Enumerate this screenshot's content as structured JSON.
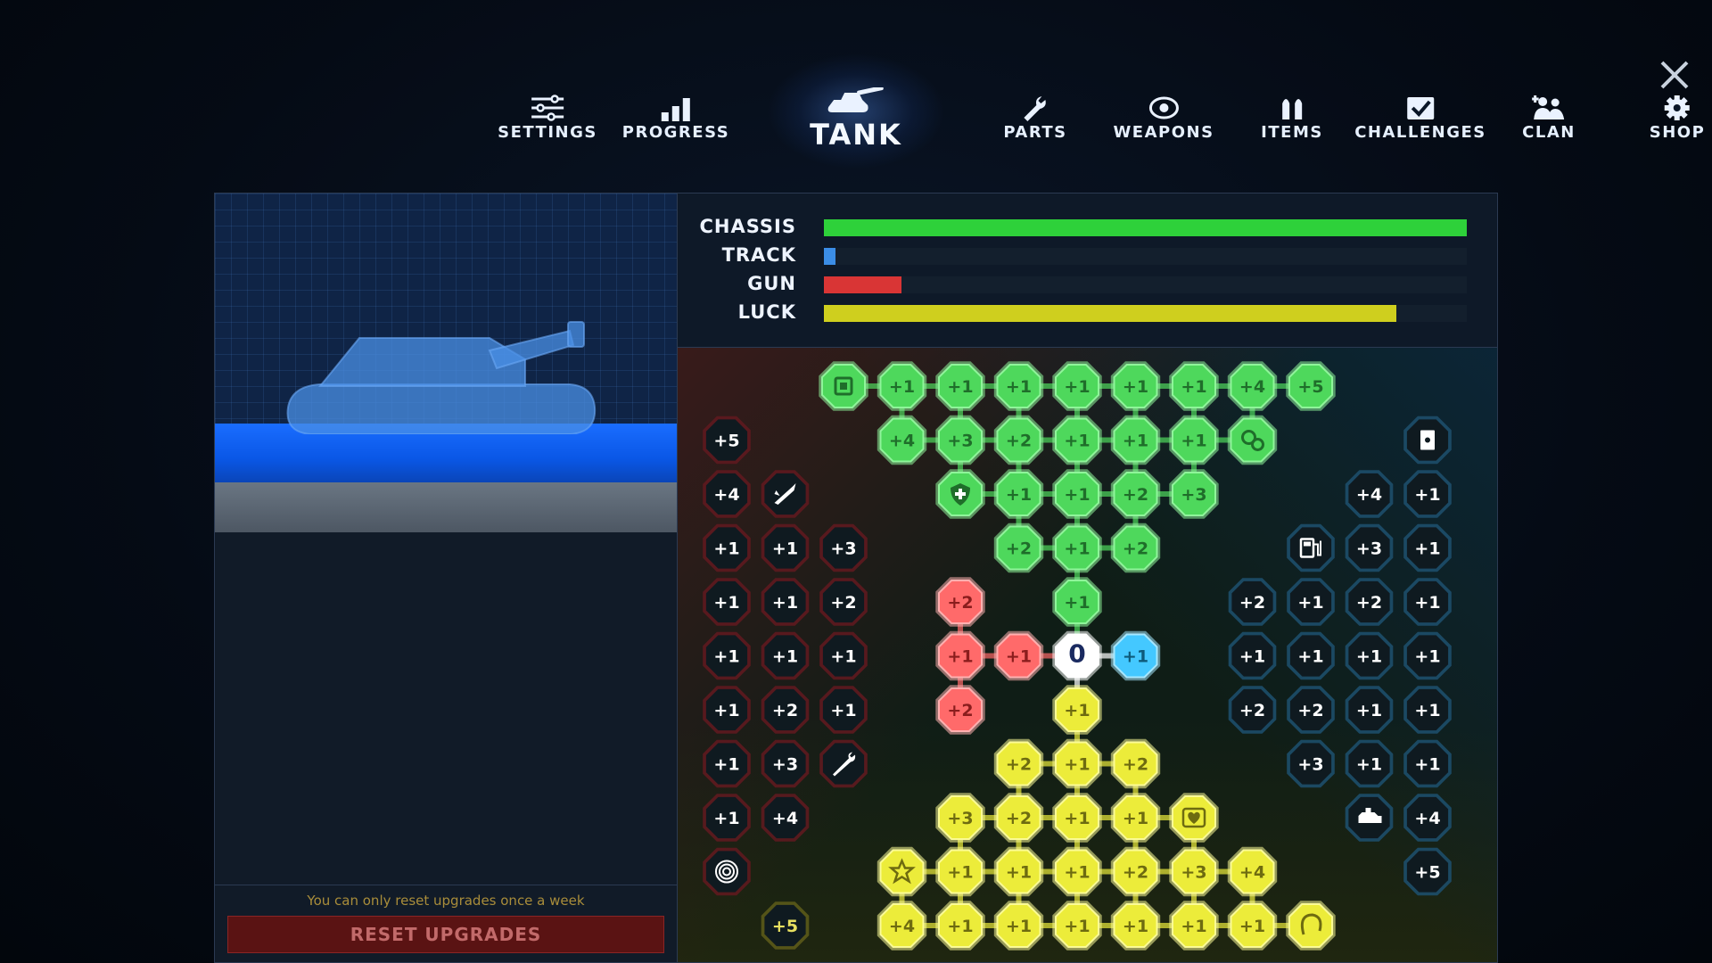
{
  "nav": {
    "items": [
      {
        "id": "settings",
        "label": "SETTINGS",
        "icon": "sliders-icon"
      },
      {
        "id": "progress",
        "label": "PROGRESS",
        "icon": "bar-chart-icon"
      },
      {
        "id": "tank",
        "label": "TANK",
        "icon": "tank-icon",
        "active": true
      },
      {
        "id": "parts",
        "label": "PARTS",
        "icon": "wrench-icon"
      },
      {
        "id": "weapons",
        "label": "WEAPONS",
        "icon": "crosshair-icon"
      },
      {
        "id": "items",
        "label": "ITEMS",
        "icon": "bullets-icon"
      },
      {
        "id": "challenges",
        "label": "CHALLENGES",
        "icon": "checkbox-icon"
      },
      {
        "id": "clan",
        "label": "CLAN",
        "icon": "group-icon"
      },
      {
        "id": "shop",
        "label": "SHOP",
        "icon": "gear-icon"
      }
    ],
    "close_icon": "close-icon"
  },
  "left": {
    "reset_note": "You can only reset upgrades once a week",
    "reset_button": "RESET UPGRADES"
  },
  "stats": [
    {
      "label": "CHASSIS",
      "level": 1.0,
      "color": "#2ed13a"
    },
    {
      "label": "TRACK",
      "level": 0.018,
      "color": "#3b8de6"
    },
    {
      "label": "GUN",
      "level": 0.12,
      "color": "#d93535"
    },
    {
      "label": "LUCK",
      "level": 0.89,
      "color": "#cfcf1e"
    }
  ],
  "colors": {
    "green": "#38d64a",
    "red": "#ff5b5b",
    "yellow": "#e8e82a",
    "blue": "#3fc3ff",
    "dark": "#0f1a20"
  },
  "grid": {
    "rows": [
      [
        [
          "",
          "",
          ""
        ],
        [
          "",
          "",
          ""
        ],
        [
          "g",
          "chip-icon",
          ""
        ],
        [
          "g",
          "+1",
          ""
        ],
        [
          "g",
          "+1",
          ""
        ],
        [
          "g",
          "+1",
          ""
        ],
        [
          "g",
          "+1",
          ""
        ],
        [
          "g",
          "+1",
          ""
        ],
        [
          "g",
          "+1",
          ""
        ],
        [
          "g",
          "+4",
          ""
        ],
        [
          "g",
          "+5",
          ""
        ],
        [
          "",
          "",
          ""
        ],
        [
          "",
          "",
          ""
        ]
      ],
      [
        [
          "r",
          "+5",
          "d"
        ],
        [
          "",
          "",
          ""
        ],
        [
          "",
          "",
          ""
        ],
        [
          "g",
          "+4",
          ""
        ],
        [
          "g",
          "+3",
          ""
        ],
        [
          "g",
          "+2",
          ""
        ],
        [
          "g",
          "+1",
          ""
        ],
        [
          "g",
          "+1",
          ""
        ],
        [
          "g",
          "+1",
          ""
        ],
        [
          "g",
          "gears-icon",
          ""
        ],
        [
          "",
          "",
          ""
        ],
        [
          "",
          "",
          ""
        ],
        [
          "b",
          "card-icon",
          "d"
        ]
      ],
      [
        [
          "r",
          "+4",
          "d"
        ],
        [
          "r",
          "rocket-icon",
          "d"
        ],
        [
          "",
          "",
          ""
        ],
        [
          "",
          "",
          ""
        ],
        [
          "g",
          "shield-icon",
          ""
        ],
        [
          "g",
          "+1",
          ""
        ],
        [
          "g",
          "+1",
          ""
        ],
        [
          "g",
          "+2",
          ""
        ],
        [
          "g",
          "+3",
          ""
        ],
        [
          "",
          "",
          ""
        ],
        [
          "",
          "",
          ""
        ],
        [
          "b",
          "+4",
          "d"
        ],
        [
          "b",
          "+1",
          "d"
        ]
      ],
      [
        [
          "r",
          "+1",
          "d"
        ],
        [
          "r",
          "+1",
          "d"
        ],
        [
          "r",
          "+3",
          "d"
        ],
        [
          "",
          "",
          ""
        ],
        [
          "",
          "",
          ""
        ],
        [
          "g",
          "+2",
          ""
        ],
        [
          "g",
          "+1",
          ""
        ],
        [
          "g",
          "+2",
          ""
        ],
        [
          "",
          "",
          ""
        ],
        [
          "",
          "",
          ""
        ],
        [
          "b",
          "fuel-icon",
          "d"
        ],
        [
          "b",
          "+3",
          "d"
        ],
        [
          "b",
          "+1",
          "d"
        ]
      ],
      [
        [
          "r",
          "+1",
          "d"
        ],
        [
          "r",
          "+1",
          "d"
        ],
        [
          "r",
          "+2",
          "d"
        ],
        [
          "",
          "",
          ""
        ],
        [
          "r",
          "+2",
          ""
        ],
        [
          "",
          "",
          ""
        ],
        [
          "g",
          "+1",
          ""
        ],
        [
          "",
          "",
          ""
        ],
        [
          "",
          "",
          ""
        ],
        [
          "b",
          "+2",
          "d"
        ],
        [
          "b",
          "+1",
          "d"
        ],
        [
          "b",
          "+2",
          "d"
        ],
        [
          "b",
          "+1",
          "d"
        ]
      ],
      [
        [
          "r",
          "+1",
          "d"
        ],
        [
          "r",
          "+1",
          "d"
        ],
        [
          "r",
          "+1",
          "d"
        ],
        [
          "",
          "",
          ""
        ],
        [
          "r",
          "+1",
          ""
        ],
        [
          "r",
          "+1",
          ""
        ],
        [
          "w",
          "0",
          ""
        ],
        [
          "b",
          "+1",
          ""
        ],
        [
          "",
          "",
          ""
        ],
        [
          "b",
          "+1",
          "d"
        ],
        [
          "b",
          "+1",
          "d"
        ],
        [
          "b",
          "+1",
          "d"
        ],
        [
          "b",
          "+1",
          "d"
        ]
      ],
      [
        [
          "r",
          "+1",
          "d"
        ],
        [
          "r",
          "+2",
          "d"
        ],
        [
          "r",
          "+1",
          "d"
        ],
        [
          "",
          "",
          ""
        ],
        [
          "r",
          "+2",
          ""
        ],
        [
          "",
          "",
          ""
        ],
        [
          "y",
          "+1",
          ""
        ],
        [
          "",
          "",
          ""
        ],
        [
          "",
          "",
          ""
        ],
        [
          "b",
          "+2",
          "d"
        ],
        [
          "b",
          "+2",
          "d"
        ],
        [
          "b",
          "+1",
          "d"
        ],
        [
          "b",
          "+1",
          "d"
        ]
      ],
      [
        [
          "r",
          "+1",
          "d"
        ],
        [
          "r",
          "+3",
          "d"
        ],
        [
          "r",
          "wrench-icon",
          "d"
        ],
        [
          "",
          "",
          ""
        ],
        [
          "",
          "",
          ""
        ],
        [
          "y",
          "+2",
          ""
        ],
        [
          "y",
          "+1",
          ""
        ],
        [
          "y",
          "+2",
          ""
        ],
        [
          "",
          "",
          ""
        ],
        [
          "",
          "",
          ""
        ],
        [
          "b",
          "+3",
          "d"
        ],
        [
          "b",
          "+1",
          "d"
        ],
        [
          "b",
          "+1",
          "d"
        ]
      ],
      [
        [
          "r",
          "+1",
          "d"
        ],
        [
          "r",
          "+4",
          "d"
        ],
        [
          "",
          "",
          ""
        ],
        [
          "",
          "",
          ""
        ],
        [
          "y",
          "+3",
          ""
        ],
        [
          "y",
          "+2",
          ""
        ],
        [
          "y",
          "+1",
          ""
        ],
        [
          "y",
          "+1",
          ""
        ],
        [
          "y",
          "heart-shield-icon",
          ""
        ],
        [
          "",
          "",
          ""
        ],
        [
          "",
          "",
          ""
        ],
        [
          "b",
          "engine-icon",
          "d"
        ],
        [
          "b",
          "+4",
          "d"
        ]
      ],
      [
        [
          "r",
          "target-icon",
          "d"
        ],
        [
          "",
          "",
          ""
        ],
        [
          "",
          "",
          ""
        ],
        [
          "y",
          "star-icon",
          ""
        ],
        [
          "y",
          "+1",
          ""
        ],
        [
          "y",
          "+1",
          ""
        ],
        [
          "y",
          "+1",
          ""
        ],
        [
          "y",
          "+2",
          ""
        ],
        [
          "y",
          "+3",
          ""
        ],
        [
          "y",
          "+4",
          ""
        ],
        [
          "",
          "",
          ""
        ],
        [
          "",
          "",
          ""
        ],
        [
          "b",
          "+5",
          "d"
        ]
      ],
      [
        [
          "",
          "",
          ""
        ],
        [
          "y",
          "+5",
          "d"
        ],
        [
          "",
          "",
          ""
        ],
        [
          "y",
          "+4",
          ""
        ],
        [
          "y",
          "+1",
          ""
        ],
        [
          "y",
          "+1",
          ""
        ],
        [
          "y",
          "+1",
          ""
        ],
        [
          "y",
          "+1",
          ""
        ],
        [
          "y",
          "+1",
          ""
        ],
        [
          "y",
          "+1",
          ""
        ],
        [
          "y",
          "horseshoe-icon",
          ""
        ],
        [
          "",
          "",
          ""
        ],
        [
          "",
          "",
          ""
        ]
      ]
    ]
  }
}
